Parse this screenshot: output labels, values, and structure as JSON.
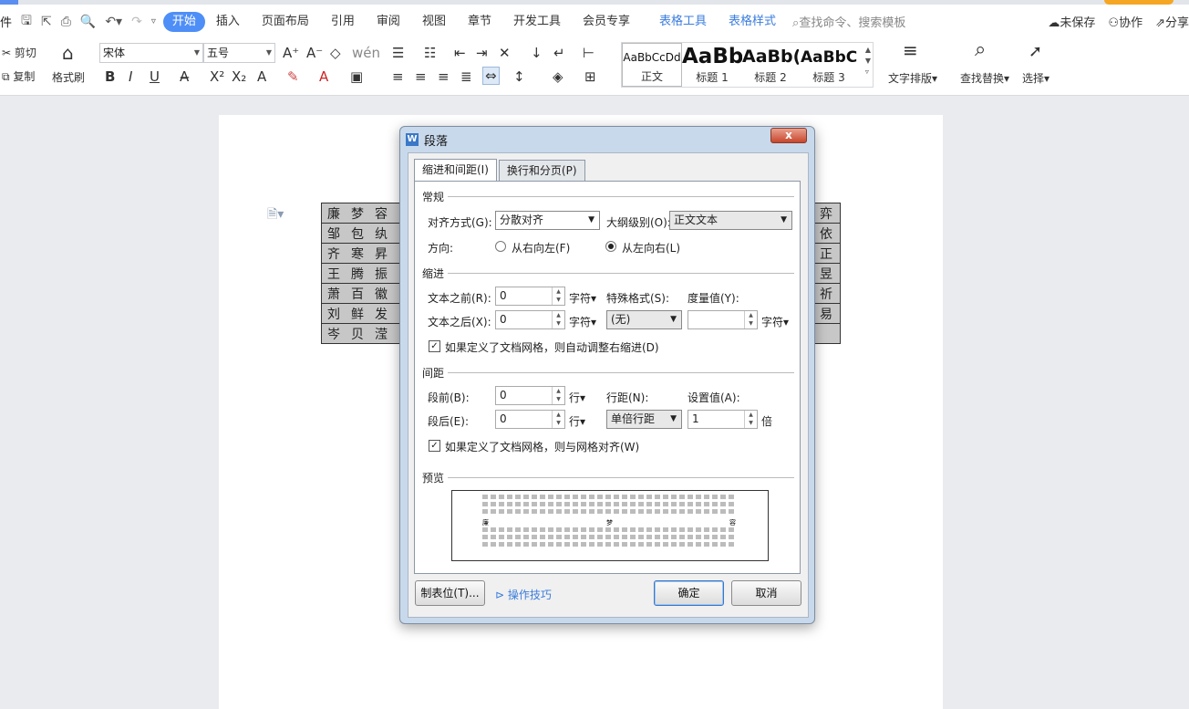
{
  "menubar": {
    "left_fragment": "件",
    "tabs": [
      "开始",
      "插入",
      "页面布局",
      "引用",
      "审阅",
      "视图",
      "章节",
      "开发工具",
      "会员专享"
    ],
    "table_tabs": [
      "表格工具",
      "表格样式"
    ],
    "search_placeholder": "查找命令、搜索模板",
    "unsaved": "未保存",
    "collab": "协作",
    "share": "分享"
  },
  "ribbon": {
    "cut": "剪切",
    "copy": "复制",
    "format_painter": "格式刷",
    "font_name": "宋体",
    "font_size": "五号",
    "styles": [
      {
        "preview": "AaBbCcDd",
        "label": "正文"
      },
      {
        "preview": "AaBb",
        "label": "标题 1"
      },
      {
        "preview": "AaBb(",
        "label": "标题 2"
      },
      {
        "preview": "AaBbC",
        "label": "标题 3"
      }
    ],
    "text_layout": "文字排版",
    "find_replace": "查找替换",
    "select": "选择"
  },
  "document": {
    "table_left": [
      [
        "廉",
        "梦",
        "容"
      ],
      [
        "邹",
        "包",
        "纨"
      ],
      [
        "齐",
        "寒",
        "昇"
      ],
      [
        "王",
        "腾",
        "振"
      ],
      [
        "萧",
        "百",
        "徽"
      ],
      [
        "刘",
        "鲜",
        "发"
      ],
      [
        "岑",
        "贝",
        "滢"
      ]
    ],
    "table_right": [
      "弈",
      "依",
      "正",
      "昱",
      "祈",
      "易",
      ""
    ]
  },
  "dialog": {
    "title": "段落",
    "close": "x",
    "tabs": [
      "缩进和间距(I)",
      "换行和分页(P)"
    ],
    "general": "常规",
    "alignment_label": "对齐方式(G):",
    "alignment_value": "分散对齐",
    "outline_label": "大纲级别(O):",
    "outline_value": "正文文本",
    "direction_label": "方向:",
    "rtl": "从右向左(F)",
    "ltr": "从左向右(L)",
    "indent": "缩进",
    "before_text_label": "文本之前(R):",
    "before_text_value": "0",
    "after_text_label": "文本之后(X):",
    "after_text_value": "0",
    "unit_char": "字符",
    "special_label": "特殊格式(S):",
    "special_value": "(无)",
    "measure_label": "度量值(Y):",
    "measure_value": "",
    "auto_indent": "如果定义了文档网格，则自动调整右缩进(D)",
    "spacing": "间距",
    "before_para_label": "段前(B):",
    "before_para_value": "0",
    "after_para_label": "段后(E):",
    "after_para_value": "0",
    "unit_line": "行",
    "line_spacing_label": "行距(N):",
    "line_spacing_value": "单倍行距",
    "set_value_label": "设置值(A):",
    "set_value": "1",
    "unit_times": "倍",
    "grid_align": "如果定义了文档网格，则与网格对齐(W)",
    "preview": "预览",
    "preview_words": [
      "廉",
      "梦",
      "容"
    ],
    "tabs_button": "制表位(T)...",
    "tips": "操作技巧",
    "ok": "确定",
    "cancel": "取消"
  },
  "colors": {
    "accent": "#4e8ef7",
    "link": "#3b7ddd",
    "dialog_frame": "#c9d9ec"
  }
}
